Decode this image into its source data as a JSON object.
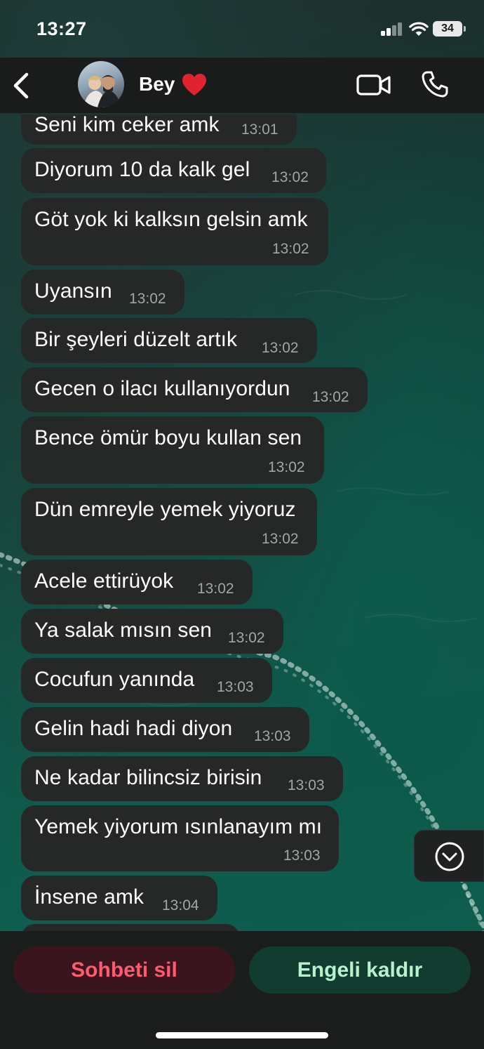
{
  "status_bar": {
    "time": "13:27",
    "battery": "34",
    "icons": [
      "signal-icon",
      "wifi-icon",
      "battery-icon"
    ]
  },
  "header": {
    "back_icon": "chevron-left-icon",
    "contact_name": "Bey",
    "name_emoji": "red-heart-icon",
    "actions": [
      "video-call-icon",
      "phone-icon"
    ]
  },
  "messages": [
    {
      "text": "Seni kim ceker amk",
      "time": "13:01"
    },
    {
      "text": "Diyorum 10 da kalk gel",
      "time": "13:02"
    },
    {
      "text": "Göt yok ki kalksın gelsin amk",
      "time": "13:02"
    },
    {
      "text": "Uyansın",
      "time": "13:02"
    },
    {
      "text": "Bir şeyleri düzelt artık",
      "time": "13:02"
    },
    {
      "text": "Gecen o ilacı kullanıyordun",
      "time": "13:02"
    },
    {
      "text": "Bence ömür boyu kullan sen",
      "time": "13:02"
    },
    {
      "text": "Dün emreyle yemek yiyoruz",
      "time": "13:02"
    },
    {
      "text": "Acele ettirüyok",
      "time": "13:02"
    },
    {
      "text": "Ya salak mısın sen",
      "time": "13:02"
    },
    {
      "text": "Cocufun yanında",
      "time": "13:03"
    },
    {
      "text": "Gelin hadi hadi diyon",
      "time": "13:03"
    },
    {
      "text": "Ne kadar bilincsiz birisin",
      "time": "13:03"
    },
    {
      "text": "Yemek yiyorum ısınlanayım mı",
      "time": "13:03"
    },
    {
      "text": "İnsene amk",
      "time": "13:04"
    }
  ],
  "scroll_button_icon": "chevron-down-circle-icon",
  "bottom_bar": {
    "delete_label": "Sohbeti sil",
    "unblock_label": "Engeli kaldır"
  },
  "colors": {
    "bubble": "#262727",
    "delete_text": "#ff5a6e",
    "unblock_text": "#b9f1cf",
    "heart": "#e0232e"
  }
}
